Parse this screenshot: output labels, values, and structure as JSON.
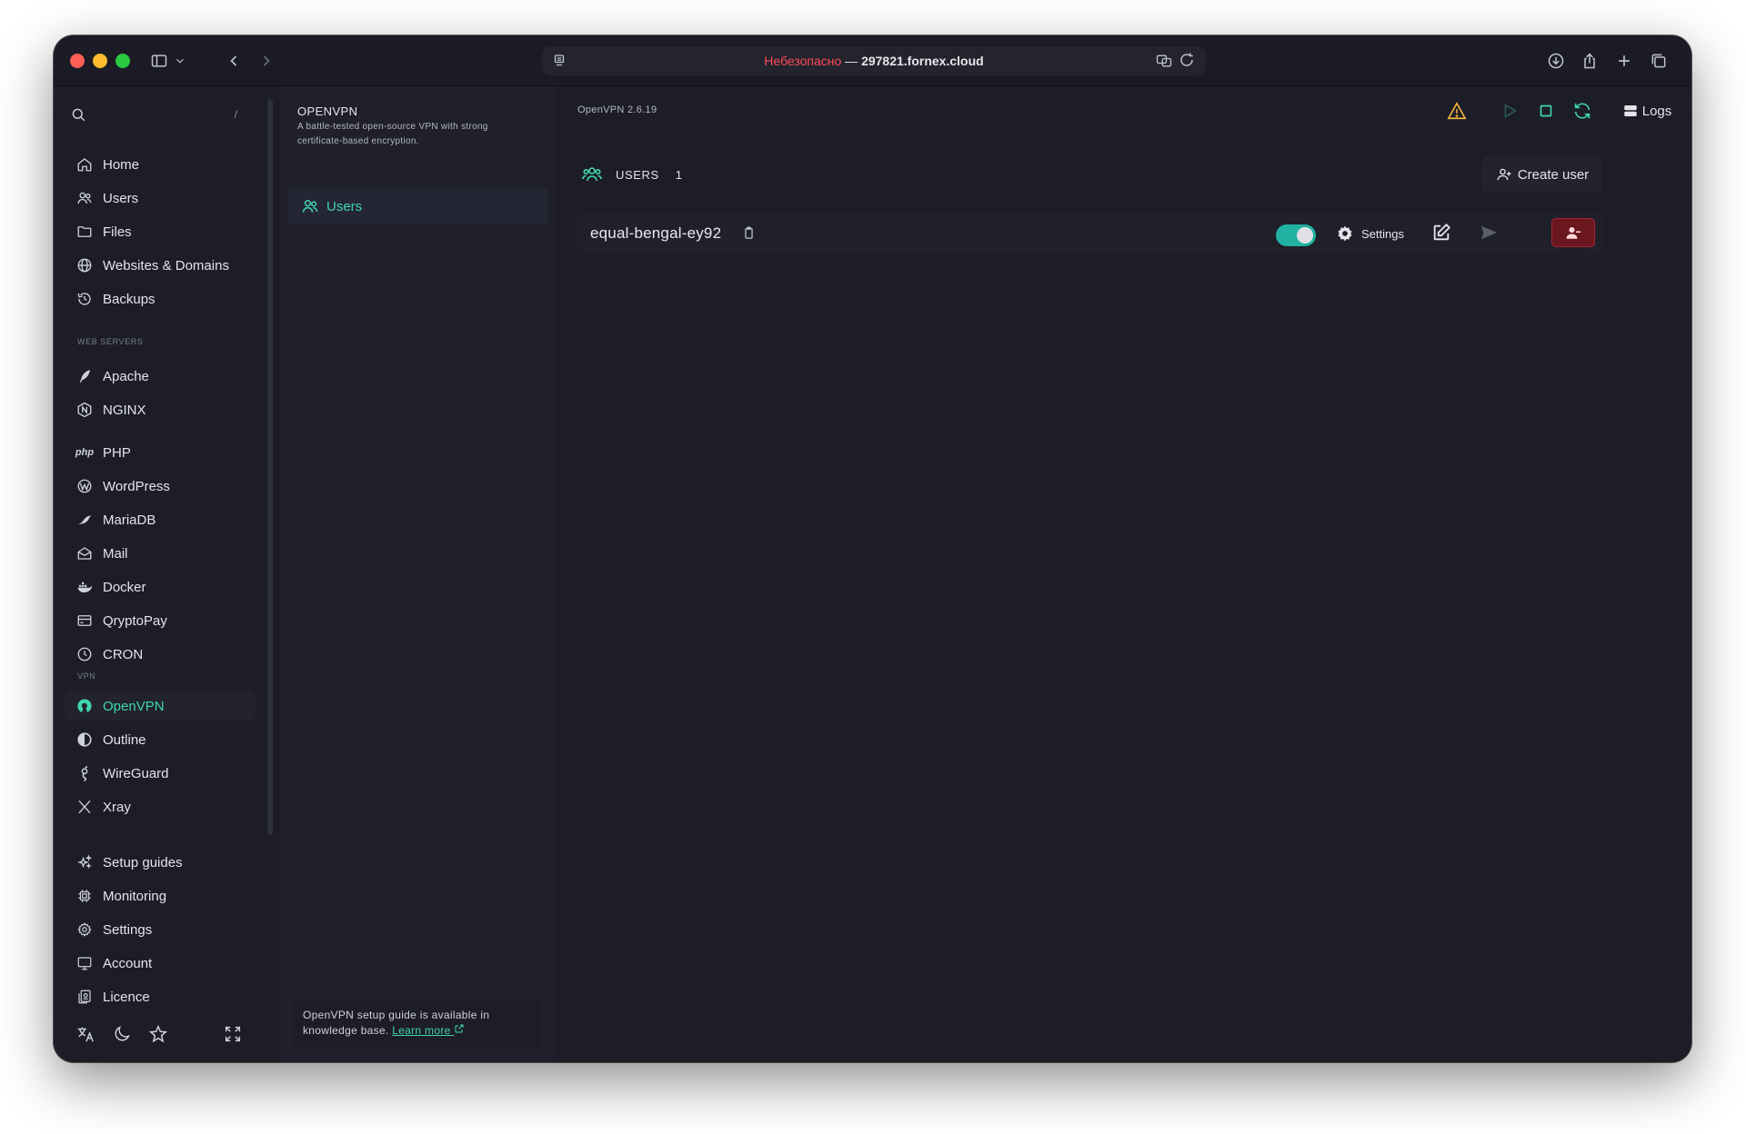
{
  "browser": {
    "url_insecure": "Небезопасно",
    "url_sep": " — ",
    "url_host": "297821.fornex.cloud"
  },
  "sidebar": {
    "search_shortcut": "/",
    "items": [
      {
        "label": "Home",
        "icon": "home-icon"
      },
      {
        "label": "Users",
        "icon": "users-icon"
      },
      {
        "label": "Files",
        "icon": "folder-icon"
      },
      {
        "label": "Websites & Domains",
        "icon": "globe-icon"
      },
      {
        "label": "Backups",
        "icon": "history-icon"
      }
    ],
    "section_web": "WEB SERVERS",
    "web_items": [
      {
        "label": "Apache",
        "icon": "feather-icon"
      },
      {
        "label": "NGINX",
        "icon": "nginx-icon"
      }
    ],
    "misc_items": [
      {
        "label": "PHP",
        "icon": "php-icon",
        "icon_text": "php"
      },
      {
        "label": "WordPress",
        "icon": "wordpress-icon"
      },
      {
        "label": "MariaDB",
        "icon": "mariadb-icon"
      },
      {
        "label": "Mail",
        "icon": "mail-icon"
      },
      {
        "label": "Docker",
        "icon": "docker-icon"
      },
      {
        "label": "QryptoPay",
        "icon": "wallet-icon"
      },
      {
        "label": "CRON",
        "icon": "clock-icon"
      }
    ],
    "section_vpn": "VPN",
    "vpn_items": [
      {
        "label": "OpenVPN",
        "icon": "openvpn-icon"
      },
      {
        "label": "Outline",
        "icon": "outline-icon"
      },
      {
        "label": "WireGuard",
        "icon": "wireguard-icon"
      },
      {
        "label": "Xray",
        "icon": "xray-icon"
      }
    ],
    "bottom_items": [
      {
        "label": "Setup guides",
        "icon": "sparkles-icon"
      },
      {
        "label": "Monitoring",
        "icon": "cpu-icon"
      },
      {
        "label": "Settings",
        "icon": "gear-icon"
      },
      {
        "label": "Account",
        "icon": "monitor-icon"
      },
      {
        "label": "Licence",
        "icon": "license-icon"
      }
    ]
  },
  "module": {
    "title": "OPENVPN",
    "description": "A battle-tested open-source VPN with strong certificate-based encryption.",
    "nav_users": "Users",
    "note_text": "OpenVPN setup guide is available in knowledge base.",
    "note_link": "Learn more"
  },
  "main": {
    "version": "OpenVPN 2.6.19",
    "logs_label": "Logs",
    "users_label": "USERS",
    "users_count": "1",
    "create_user": "Create user",
    "user": {
      "name": "equal-bengal-ey92",
      "enabled": true,
      "settings_label": "Settings"
    }
  },
  "colors": {
    "accent": "#3fd6b1",
    "warning": "#f2b33d",
    "danger": "#a5222e",
    "background": "#1c1d27"
  }
}
